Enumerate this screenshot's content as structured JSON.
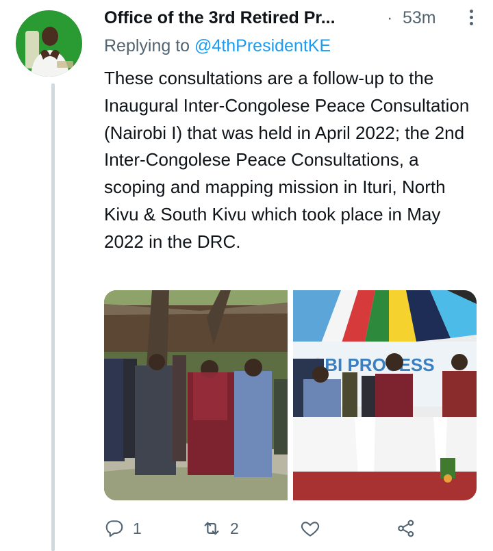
{
  "tweet": {
    "author_name": "Office of the 3rd Retired Pr...",
    "separator": "·",
    "timestamp": "53m",
    "replying_prefix": "Replying to",
    "replying_handle": "@4thPresidentKE",
    "text": "These consultations are a follow-up to the Inaugural Inter-Congolese Peace Consultation (Nairobi I) that was held in April 2022; the 2nd Inter-Congolese Peace Consultations, a scoping and mapping mission in Ituri, North Kivu & South Kivu which took place in May 2022 in the DRC.",
    "photo_right_banner_text": "IROBI PROCESS"
  },
  "actions": {
    "reply_count": "1",
    "retweet_count": "2",
    "like_count": "",
    "icons": [
      "reply-icon",
      "retweet-icon",
      "like-icon",
      "share-icon"
    ]
  },
  "colors": {
    "text_primary": "#0f1419",
    "text_secondary": "#536471",
    "link": "#1d9bf0",
    "thread_line": "#cfd9de"
  }
}
